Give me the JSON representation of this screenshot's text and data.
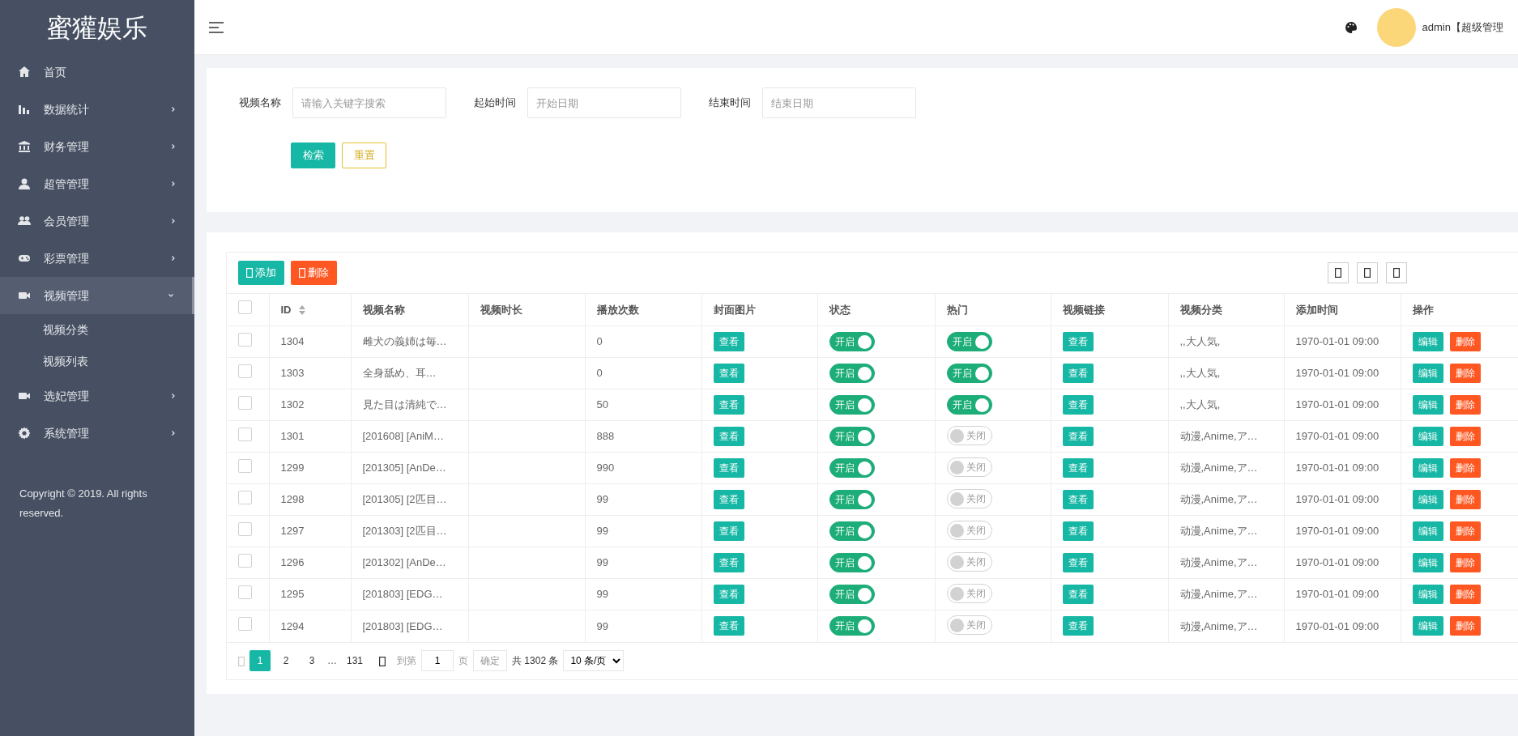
{
  "brand": "蜜獾娱乐",
  "sidebar": {
    "items": [
      {
        "label": "首页",
        "selected": false
      },
      {
        "label": "数据统计",
        "expanded": false,
        "selected": false
      },
      {
        "label": "财务管理",
        "expanded": false,
        "selected": false
      },
      {
        "label": "超管管理",
        "expanded": false,
        "selected": false
      },
      {
        "label": "会员管理",
        "expanded": false,
        "selected": false
      },
      {
        "label": "彩票管理",
        "expanded": false,
        "selected": false
      },
      {
        "label": "视频管理",
        "expanded": true,
        "selected": true,
        "children": [
          {
            "label": "视频分类"
          },
          {
            "label": "视频列表"
          }
        ]
      },
      {
        "label": "选妃管理",
        "expanded": false,
        "selected": false
      },
      {
        "label": "系统管理",
        "expanded": false,
        "selected": false
      }
    ],
    "copyright": "Copyright © 2019. All rights reserved."
  },
  "header": {
    "user": "admin【超级管理"
  },
  "filters": [
    {
      "label": "视频名称",
      "placeholder": "请输入关键字搜索"
    },
    {
      "label": "起始时间",
      "placeholder": "开始日期"
    },
    {
      "label": "结束时间",
      "placeholder": "结束日期"
    }
  ],
  "filter_buttons": {
    "search": "检索",
    "reset": "重置"
  },
  "toolbar": {
    "add": "添加",
    "delete": "删除"
  },
  "table": {
    "select_all_checked": false,
    "columns": [
      {
        "label": "ID",
        "sortable": true
      },
      {
        "label": "视频名称",
        "sortable": false
      },
      {
        "label": "视频时长",
        "sortable": false
      },
      {
        "label": "播放次数",
        "sortable": false
      },
      {
        "label": "封面图片",
        "sortable": false
      },
      {
        "label": "状态",
        "sortable": false
      },
      {
        "label": "热门",
        "sortable": false
      },
      {
        "label": "视频链接",
        "sortable": false
      },
      {
        "label": "视频分类",
        "sortable": false
      },
      {
        "label": "添加时间",
        "sortable": false
      },
      {
        "label": "操作",
        "sortable": false
      }
    ],
    "rows": [
      {
        "checked": false,
        "id": "1304",
        "name": "雌犬の義姉は毎…",
        "plays": "0",
        "cover": "查看",
        "status": {
          "label": "开启",
          "on": true
        },
        "hot": {
          "label": "开启",
          "on": true
        },
        "link": "查看",
        "category": ",,大人気,",
        "time": "1970-01-01 09:00",
        "edit": "编辑",
        "delete": "删除"
      },
      {
        "checked": false,
        "id": "1303",
        "name": "全身舐め、耳…",
        "plays": "0",
        "cover": "查看",
        "status": {
          "label": "开启",
          "on": true
        },
        "hot": {
          "label": "开启",
          "on": true
        },
        "link": "查看",
        "category": ",,大人気,",
        "time": "1970-01-01 09:00",
        "edit": "编辑",
        "delete": "删除"
      },
      {
        "checked": false,
        "id": "1302",
        "name": "見た目は清純で…",
        "plays": "50",
        "cover": "查看",
        "status": {
          "label": "开启",
          "on": true
        },
        "hot": {
          "label": "开启",
          "on": true
        },
        "link": "查看",
        "category": ",,大人気,",
        "time": "1970-01-01 09:00",
        "edit": "编辑",
        "delete": "删除"
      },
      {
        "checked": false,
        "id": "1301",
        "name": "[201608] [AniM…",
        "plays": "888",
        "cover": "查看",
        "status": {
          "label": "开启",
          "on": true
        },
        "hot": {
          "label": "关闭",
          "on": false
        },
        "link": "查看",
        "category": "动漫,Anime,ア…",
        "time": "1970-01-01 09:00",
        "edit": "编辑",
        "delete": "删除"
      },
      {
        "checked": false,
        "id": "1299",
        "name": "[201305] [AnDe…",
        "plays": "990",
        "cover": "查看",
        "status": {
          "label": "开启",
          "on": true
        },
        "hot": {
          "label": "关闭",
          "on": false
        },
        "link": "查看",
        "category": "动漫,Anime,ア…",
        "time": "1970-01-01 09:00",
        "edit": "编辑",
        "delete": "删除"
      },
      {
        "checked": false,
        "id": "1298",
        "name": "[201305] [2匹目…",
        "plays": "99",
        "cover": "查看",
        "status": {
          "label": "开启",
          "on": true
        },
        "hot": {
          "label": "关闭",
          "on": false
        },
        "link": "查看",
        "category": "动漫,Anime,ア…",
        "time": "1970-01-01 09:00",
        "edit": "编辑",
        "delete": "删除"
      },
      {
        "checked": false,
        "id": "1297",
        "name": "[201303] [2匹目…",
        "plays": "99",
        "cover": "查看",
        "status": {
          "label": "开启",
          "on": true
        },
        "hot": {
          "label": "关闭",
          "on": false
        },
        "link": "查看",
        "category": "动漫,Anime,ア…",
        "time": "1970-01-01 09:00",
        "edit": "编辑",
        "delete": "删除"
      },
      {
        "checked": false,
        "id": "1296",
        "name": "[201302] [AnDe…",
        "plays": "99",
        "cover": "查看",
        "status": {
          "label": "开启",
          "on": true
        },
        "hot": {
          "label": "关闭",
          "on": false
        },
        "link": "查看",
        "category": "动漫,Anime,ア…",
        "time": "1970-01-01 09:00",
        "edit": "编辑",
        "delete": "删除"
      },
      {
        "checked": false,
        "id": "1295",
        "name": "[201803] [EDG…",
        "plays": "99",
        "cover": "查看",
        "status": {
          "label": "开启",
          "on": true
        },
        "hot": {
          "label": "关闭",
          "on": false
        },
        "link": "查看",
        "category": "动漫,Anime,ア…",
        "time": "1970-01-01 09:00",
        "edit": "编辑",
        "delete": "删除"
      },
      {
        "checked": false,
        "id": "1294",
        "name": "[201803] [EDG…",
        "plays": "99",
        "cover": "查看",
        "status": {
          "label": "开启",
          "on": true
        },
        "hot": {
          "label": "关闭",
          "on": false
        },
        "link": "查看",
        "category": "动漫,Anime,ア…",
        "time": "1970-01-01 09:00",
        "edit": "编辑",
        "delete": "删除"
      }
    ]
  },
  "pagination": {
    "pages": [
      {
        "label": "1",
        "selected": true
      },
      {
        "label": "2",
        "selected": false
      },
      {
        "label": "3",
        "selected": false
      }
    ],
    "ellipsis": "…",
    "last": "131",
    "goto_label": "到第",
    "goto_value": "1",
    "page_unit": "页",
    "confirm": "确定",
    "total": "共 1302 条",
    "page_size": "10 条/页"
  }
}
